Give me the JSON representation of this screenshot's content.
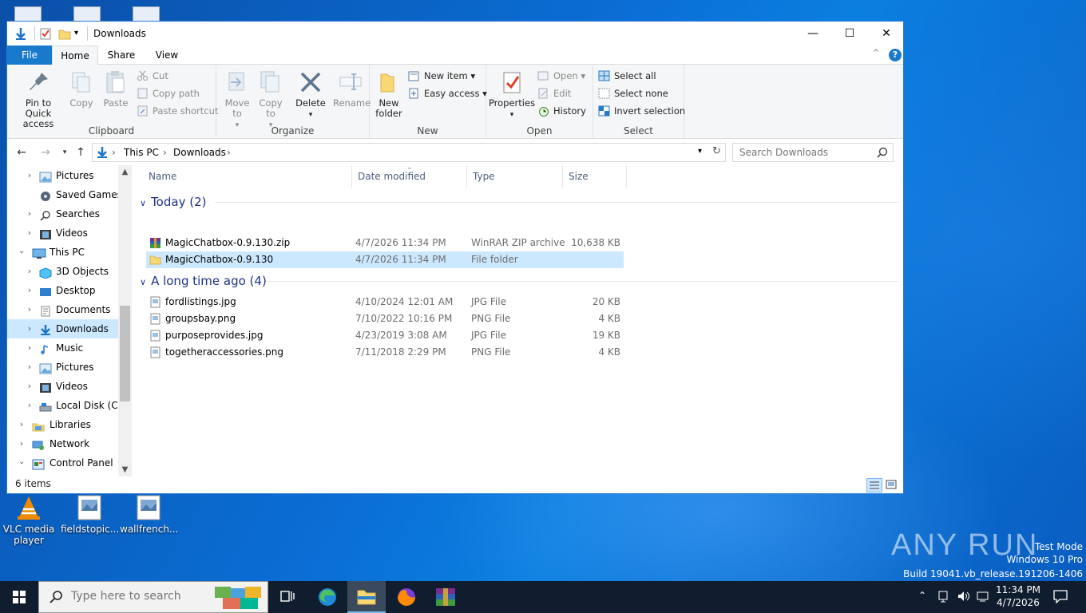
{
  "desktop": {
    "icons": [
      {
        "label": "VLC media player"
      },
      {
        "label": "fieldstopic..."
      },
      {
        "label": "wallfrench..."
      }
    ]
  },
  "window": {
    "title": "Downloads",
    "controls": {
      "minimize": "—",
      "maximize": "☐",
      "close": "✕"
    }
  },
  "ribbon": {
    "tabs": [
      "File",
      "Home",
      "Share",
      "View"
    ],
    "clipboard": {
      "label": "Clipboard",
      "pin": "Pin to Quick access",
      "copy": "Copy",
      "paste": "Paste",
      "cut": "Cut",
      "copy_path": "Copy path",
      "paste_shortcut": "Paste shortcut"
    },
    "organize": {
      "label": "Organize",
      "move_to": "Move to",
      "copy_to": "Copy to",
      "delete": "Delete",
      "rename": "Rename"
    },
    "new": {
      "label": "New",
      "new_folder": "New folder",
      "new_item": "New item",
      "easy_access": "Easy access"
    },
    "open": {
      "label": "Open",
      "properties": "Properties",
      "open": "Open",
      "edit": "Edit",
      "history": "History"
    },
    "select": {
      "label": "Select",
      "select_all": "Select all",
      "select_none": "Select none",
      "invert": "Invert selection"
    }
  },
  "address": {
    "crumbs": [
      "This PC",
      "Downloads"
    ],
    "search_placeholder": "Search Downloads"
  },
  "nav": {
    "items": [
      {
        "label": "Pictures",
        "icon": "pictures-icon"
      },
      {
        "label": "Saved Games",
        "icon": "saved-games-icon"
      },
      {
        "label": "Searches",
        "icon": "search-icon"
      },
      {
        "label": "Videos",
        "icon": "videos-icon"
      },
      {
        "label": "This PC",
        "icon": "this-pc-icon"
      },
      {
        "label": "3D Objects",
        "icon": "3d-objects-icon"
      },
      {
        "label": "Desktop",
        "icon": "desktop-icon"
      },
      {
        "label": "Documents",
        "icon": "documents-icon"
      },
      {
        "label": "Downloads",
        "icon": "downloads-icon"
      },
      {
        "label": "Music",
        "icon": "music-icon"
      },
      {
        "label": "Pictures",
        "icon": "pictures-icon"
      },
      {
        "label": "Videos",
        "icon": "videos-icon"
      },
      {
        "label": "Local Disk (C:)",
        "icon": "disk-icon"
      },
      {
        "label": "Libraries",
        "icon": "libraries-icon"
      },
      {
        "label": "Network",
        "icon": "network-icon"
      },
      {
        "label": "Control Panel",
        "icon": "control-panel-icon"
      }
    ]
  },
  "files": {
    "columns": [
      "Name",
      "Date modified",
      "Type",
      "Size"
    ],
    "groups": [
      {
        "title": "Today (2)",
        "rows": [
          {
            "name": "MagicChatbox-0.9.130.zip",
            "date": "4/7/2026 11:34 PM",
            "type": "WinRAR ZIP archive",
            "size": "10,638 KB",
            "icon": "winrar-icon"
          },
          {
            "name": "MagicChatbox-0.9.130",
            "date": "4/7/2026 11:34 PM",
            "type": "File folder",
            "size": "",
            "icon": "folder-icon"
          }
        ]
      },
      {
        "title": "A long time ago (4)",
        "rows": [
          {
            "name": "fordlistings.jpg",
            "date": "4/10/2024 12:01 AM",
            "type": "JPG File",
            "size": "20 KB",
            "icon": "image-file-icon"
          },
          {
            "name": "groupsbay.png",
            "date": "7/10/2022 10:16 PM",
            "type": "PNG File",
            "size": "4 KB",
            "icon": "image-file-icon"
          },
          {
            "name": "purposeprovides.jpg",
            "date": "4/23/2019 3:08 AM",
            "type": "JPG File",
            "size": "19 KB",
            "icon": "image-file-icon"
          },
          {
            "name": "togetheraccessories.png",
            "date": "7/11/2018 2:29 PM",
            "type": "PNG File",
            "size": "4 KB",
            "icon": "image-file-icon"
          }
        ]
      }
    ]
  },
  "status": {
    "count": "6 items"
  },
  "watermark": {
    "brand": "ANY RUN",
    "line1": "Test Mode",
    "line2": "Windows 10 Pro",
    "line3": "Build 19041.vb_release.191206-1406"
  },
  "taskbar": {
    "search_placeholder": "Type here to search",
    "time": "11:34 PM",
    "date": "4/7/2026"
  },
  "colors": {
    "accent": "#1979ca",
    "selection": "#cce8ff",
    "group_header": "#1e3287"
  }
}
